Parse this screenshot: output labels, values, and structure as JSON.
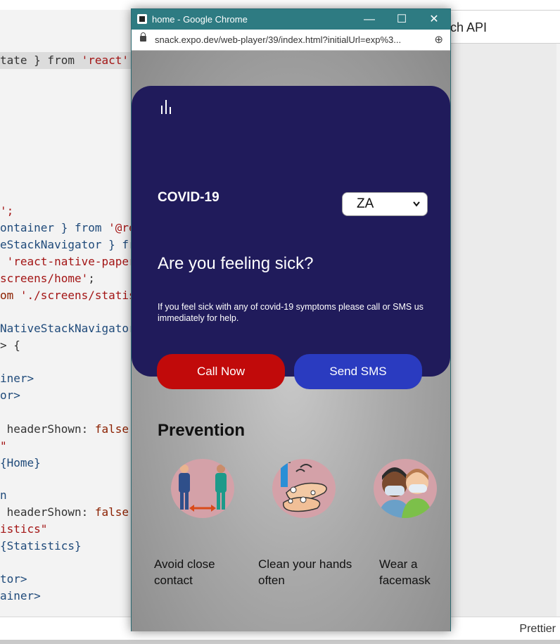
{
  "editor": {
    "doc_tab_label": "ch API",
    "status_prettier": "Prettier",
    "code_lines": [
      {
        "a": "tate } from ",
        "b": "'react'",
        "c": ";"
      },
      {
        "a": "';"
      },
      {
        "a": "ontainer } from ",
        "b": "'@re"
      },
      {
        "a": "eStackNavigator } fr"
      },
      {
        "a": " ",
        "b": "'react-native-paper"
      },
      {
        "a": "screens/home'",
        "c": ";"
      },
      {
        "a": "om ",
        "b": "'./screens/statis"
      },
      {
        "a": "NativeStackNavigator"
      },
      {
        "a": "> {"
      },
      {
        "a": "iner>"
      },
      {
        "a": "or>"
      },
      {
        "a": " headerShown: ",
        "b": "false"
      },
      {
        "a": "\""
      },
      {
        "a": "{Home}"
      },
      {
        "a": "n"
      },
      {
        "a": " headerShown: ",
        "b": "false"
      },
      {
        "a": "istics\""
      },
      {
        "a": "{Statistics}"
      },
      {
        "a": "tor>"
      },
      {
        "a": "ainer>"
      }
    ]
  },
  "chrome": {
    "window_title": "home - Google Chrome",
    "minimize_label": "—",
    "maximize_label": "☐",
    "close_label": "✕",
    "url": "snack.expo.dev/web-player/39/index.html?initialUrl=exp%3...",
    "zoom_icon_glyph": "⊕"
  },
  "app": {
    "title": "COVID-19",
    "country_selected": "ZA",
    "question": "Are you feeling sick?",
    "description": "If you feel sick with any of covid-19 symptoms please call or SMS us immediately for help.",
    "call_button": "Call Now",
    "sms_button": "Send SMS",
    "prevention_heading": "Prevention",
    "prevention_items": [
      {
        "line1": "Avoid close",
        "line2": "contact",
        "icon": "social-distance-icon"
      },
      {
        "line1": "Clean your hands",
        "line2": "often",
        "icon": "wash-hands-icon"
      },
      {
        "line1": "Wear a",
        "line2": "facemask",
        "icon": "facemask-icon"
      }
    ]
  },
  "colors": {
    "hero_bg": "#201b5b",
    "call_bg": "#c10a0a",
    "sms_bg": "#2a3bc0",
    "titlebar_bg": "#2e7b82"
  }
}
